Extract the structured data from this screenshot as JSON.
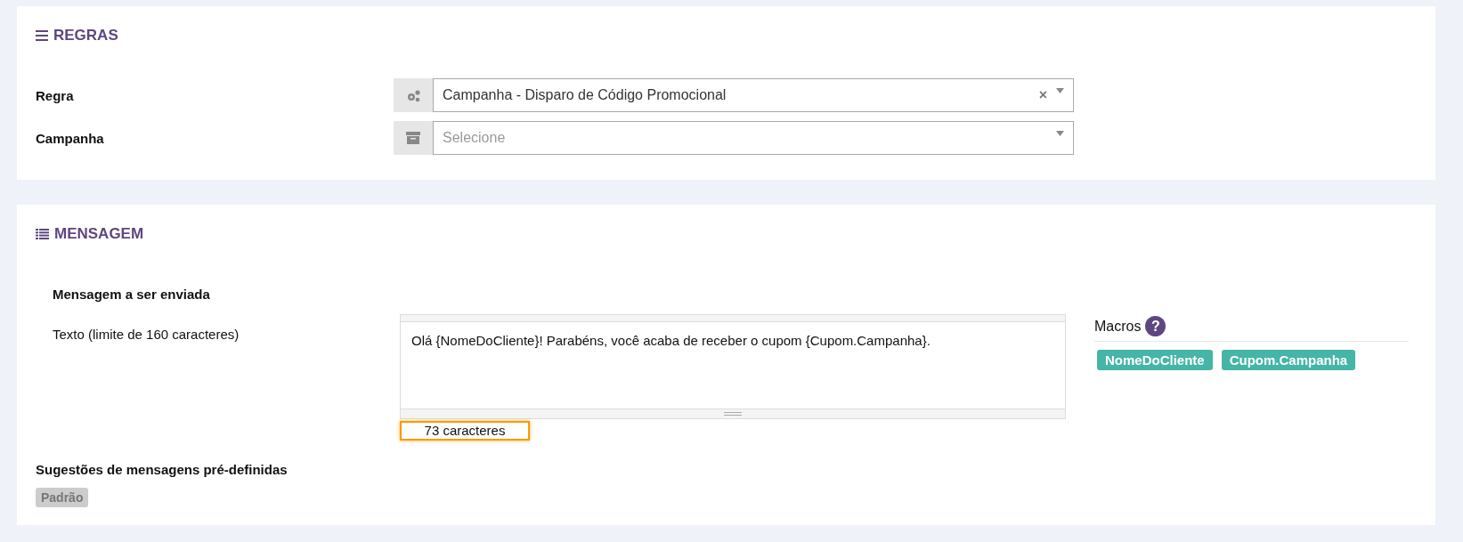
{
  "rules_panel": {
    "title": "REGRAS",
    "fields": [
      {
        "label": "Regra",
        "kind": "gears",
        "value": "Campanha - Disparo de Código Promocional",
        "clear_icon": "×"
      },
      {
        "label": "Campanha",
        "kind": "archive",
        "placeholder": "Selecione"
      }
    ]
  },
  "message_panel": {
    "title": "MENSAGEM",
    "section_label": "Mensagem a ser enviada",
    "text_label": "Texto (limite de 160 caracteres)",
    "message": "Olá {NomeDoCliente}! Parabéns, você acaba de receber o cupom {Cupom.Campanha}.",
    "counter": "73 caracteres",
    "macros_label": "Macros",
    "help_icon": "?",
    "macros": [
      "NomeDoCliente",
      "Cupom.Campanha"
    ],
    "suggestions_label": "Sugestões de mensagens pré-definidas",
    "suggestions": [
      "Padrão"
    ]
  }
}
